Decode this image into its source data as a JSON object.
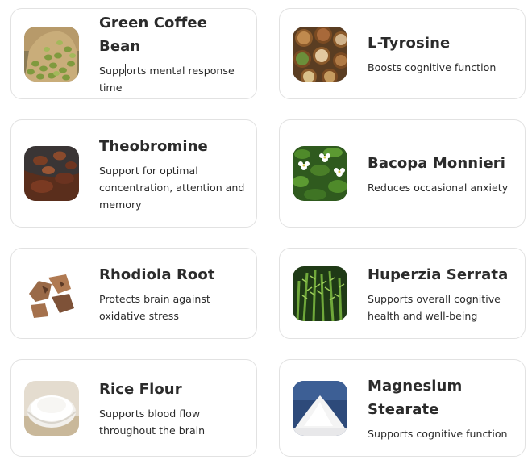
{
  "cards": [
    {
      "title": "Green Coffee Bean",
      "desc_a": "Supp",
      "desc_b": "orts mental response time",
      "image": "green-coffee-beans-image"
    },
    {
      "title": "L-Tyrosine",
      "desc": "Boosts cognitive function",
      "image": "nuts-and-seeds-image"
    },
    {
      "title": "Theobromine",
      "desc": "Support for optimal concentration, attention and memory",
      "image": "cocoa-beans-image"
    },
    {
      "title": "Bacopa Monnieri",
      "desc": "Reduces occasional anxiety",
      "image": "bacopa-flowers-image"
    },
    {
      "title": "Rhodiola Root",
      "desc": "Protects brain against oxidative stress",
      "image": "rhodiola-root-image"
    },
    {
      "title": "Huperzia Serrata",
      "desc": "Supports overall cognitive health and well-being",
      "image": "huperzia-plant-image"
    },
    {
      "title": "Rice Flour",
      "desc": "Supports blood flow throughout the brain",
      "image": "rice-flour-bowl-image"
    },
    {
      "title": "Magnesium Stearate",
      "desc": "Supports cognitive function",
      "image": "magnesium-stearate-powder-image"
    }
  ]
}
